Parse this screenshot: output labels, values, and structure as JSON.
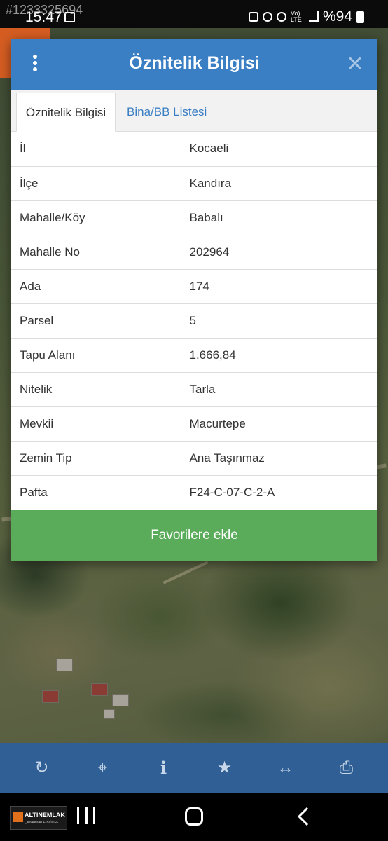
{
  "status_bar": {
    "time": "15:47",
    "battery_text": "%94",
    "network_label": "Vo) LTE"
  },
  "watermark_id": "#1233325694",
  "dialog": {
    "title": "Öznitelik Bilgisi",
    "close_label": "✕",
    "tabs": [
      {
        "label": "Öznitelik Bilgisi",
        "active": true
      },
      {
        "label": "Bina/BB Listesi",
        "active": false
      }
    ],
    "rows": [
      {
        "key": "İl",
        "value": "Kocaeli"
      },
      {
        "key": "İlçe",
        "value": "Kandıra"
      },
      {
        "key": "Mahalle/Köy",
        "value": "Babalı"
      },
      {
        "key": "Mahalle No",
        "value": "202964"
      },
      {
        "key": "Ada",
        "value": "174"
      },
      {
        "key": "Parsel",
        "value": "5"
      },
      {
        "key": "Tapu Alanı",
        "value": "1.666,84"
      },
      {
        "key": "Nitelik",
        "value": "Tarla"
      },
      {
        "key": "Mevkii",
        "value": "Macurtepe"
      },
      {
        "key": "Zemin Tip",
        "value": "Ana Taşınmaz"
      },
      {
        "key": "Pafta",
        "value": "F24-C-07-C-2-A"
      }
    ],
    "favorite_button": "Favorilere ekle"
  },
  "toolbar": {
    "icons": [
      "refresh-icon",
      "locate-icon",
      "info-icon",
      "star-icon",
      "measure-icon",
      "print-icon"
    ]
  },
  "logo": {
    "text": "ALTINEMLAK",
    "subtitle": "ÇANAKKALE BÖLGE"
  },
  "colors": {
    "header": "#3a7ec4",
    "favorite": "#5aac5a",
    "toolbar": "#2f5f95",
    "tab_active_text": "#333333",
    "tab_inactive_text": "#3a7ec4"
  }
}
